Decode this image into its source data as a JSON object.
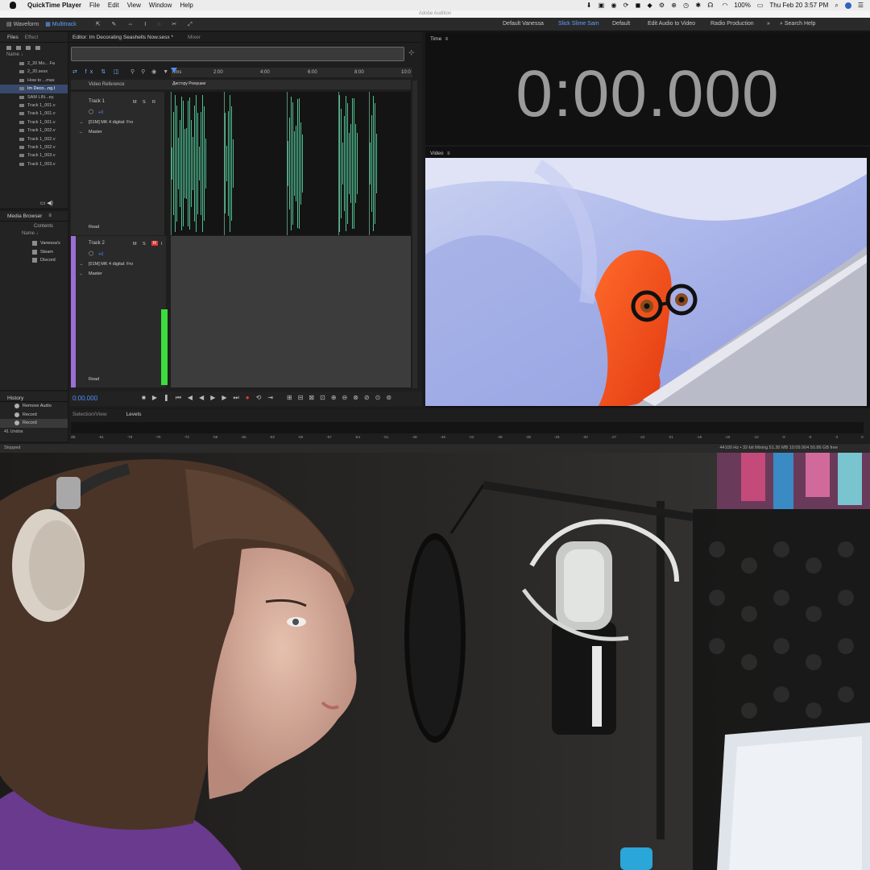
{
  "menubar": {
    "app": "QuickTime Player",
    "items": [
      "File",
      "Edit",
      "View",
      "Window",
      "Help"
    ],
    "battery": "100%",
    "clock": "Thu Feb 20  3:57 PM"
  },
  "window_title": "Adobe Audition",
  "toolbar": {
    "waveform": "Waveform",
    "multitrack": "Multitrack",
    "workspaces": [
      "Default Vanessa",
      "Slick Slime Sam",
      "Default",
      "Edit Audio to Video",
      "Radio Production"
    ],
    "search": "Search Help"
  },
  "files_panel": {
    "tab_files": "Files",
    "tab_effects": "Effect",
    "name_header": "Name ↓",
    "items": [
      "2_20 Mo... Fa",
      "2_20.sesx",
      "How to ...mas",
      "Im Deco...ng.l",
      "SAM LIN...ey.",
      "Track 1_001.v",
      "Track 1_001.v",
      "Track 1_001.v",
      "Track 1_002.v",
      "Track 1_002.v",
      "Track 1_002.v",
      "Track 1_003.v",
      "Track 1_003.v"
    ]
  },
  "media_browser": {
    "title": "Media Browser",
    "contents": "Contents",
    "name_header": "Name ↓",
    "items": [
      "Vanessa's",
      "Steam",
      "Discord"
    ]
  },
  "history": {
    "title": "History",
    "items": [
      "Remove Audio",
      "Record",
      "Record"
    ],
    "undos": "41 Undos"
  },
  "editor": {
    "tab": "Editor: Im Decorating Seashells Now.sesx *",
    "mixer": "Mixer",
    "video_reference": "Video Reference",
    "ruler": [
      "hms",
      "2:00",
      "4:00",
      "6:00",
      "8:00",
      "10:0"
    ],
    "clip_label": "Дистору Ромушки",
    "track1": {
      "name": "Track 1",
      "m": "M",
      "s": "S",
      "r": "R",
      "vol": "+0",
      "input": "[01M] MK 4 digital: Fro",
      "output": "Master",
      "mode": "Read"
    },
    "track2": {
      "name": "Track 2",
      "m": "M",
      "s": "S",
      "r": "R",
      "i": "I",
      "vol": "+0",
      "input": "[01M] MK 4 digital: Fro",
      "output": "Master",
      "mode": "Read"
    },
    "timecode": "0:00.000"
  },
  "levels": {
    "tab_selection": "Selection/View",
    "tab_levels": "Levels",
    "scale": [
      "dB",
      "-81",
      "-78",
      "-75",
      "-72",
      "-69",
      "-66",
      "-63",
      "-60",
      "-57",
      "-54",
      "-51",
      "-48",
      "-45",
      "-42",
      "-39",
      "-36",
      "-33",
      "-30",
      "-27",
      "-24",
      "-21",
      "-18",
      "-15",
      "-12",
      "-9",
      "-6",
      "-3",
      "0"
    ]
  },
  "status": {
    "left": "Stopped",
    "right": "44100 Hz • 32-bit Mixing     51.30 MB     10:09.904     50.86 GB free"
  },
  "time_panel": {
    "title": "Time",
    "time": "0:00.000"
  },
  "video_panel": {
    "title": "Video"
  },
  "colors": {
    "accent": "#4f8fff",
    "waveform": "#4fbf92",
    "track_purple": "#9b6fd6",
    "meter_green": "#3ddc3d",
    "record_red": "#e03a3a"
  }
}
